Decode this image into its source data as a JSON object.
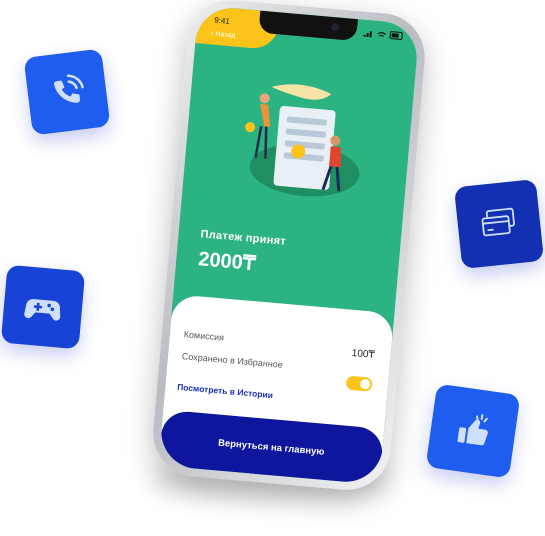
{
  "status_bar": {
    "time": "9:41"
  },
  "header": {
    "back_label": "Назад"
  },
  "payment": {
    "title": "Платеж принят",
    "amount": "2000₸"
  },
  "details": {
    "commission_label": "Комиссия",
    "commission_value": "100₸",
    "saved_label": "Сохранено в Избранное",
    "saved_toggle_on": true,
    "history_link": "Посмотреть в Истории"
  },
  "footer": {
    "home_button": "Вернуться на главную"
  },
  "colors": {
    "screen_green": "#2bb482",
    "accent_yellow": "#fcc419",
    "button_navy": "#0d169c",
    "tile_blue": "#1f5cf0"
  },
  "icons": [
    "phone-call-icon",
    "gamepad-icon",
    "credit-cards-icon",
    "thumbs-up-icon"
  ]
}
